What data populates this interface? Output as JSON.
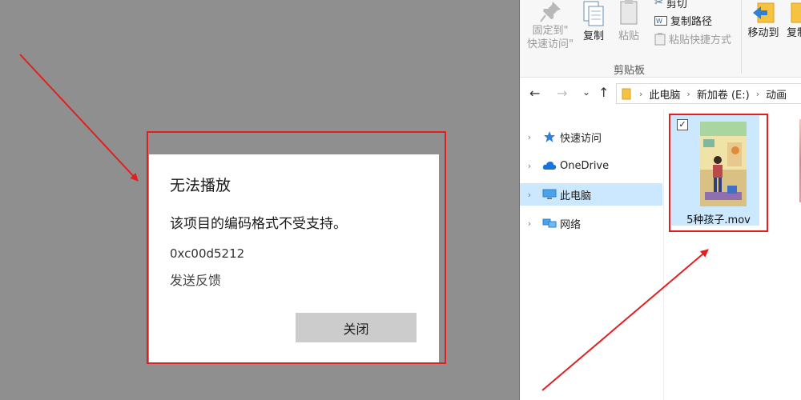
{
  "dialog": {
    "title": "无法播放",
    "message": "该项目的编码格式不受支持。",
    "error_code": "0xc00d5212",
    "feedback_link": "发送反馈",
    "close_label": "关闭"
  },
  "ribbon": {
    "pin_label_line1": "固定到\"",
    "pin_label_line2": "快速访问\"",
    "copy_label": "复制",
    "paste_label": "粘贴",
    "cut_label": "剪切",
    "copy_path_label": "复制路径",
    "paste_shortcut_label": "粘贴快捷方式",
    "group_label": "剪贴板",
    "move_to_label": "移动到",
    "copy_to_label": "复制"
  },
  "address": {
    "crumbs": [
      "此电脑",
      "新加卷 (E:)",
      "动画"
    ]
  },
  "nav_pane": {
    "items": [
      {
        "label": "快速访问",
        "icon": "star-icon"
      },
      {
        "label": "OneDrive",
        "icon": "cloud-icon"
      },
      {
        "label": "此电脑",
        "icon": "computer-icon"
      },
      {
        "label": "网络",
        "icon": "network-icon"
      }
    ]
  },
  "files": [
    {
      "name": "5种孩子.mov",
      "checked": true
    }
  ],
  "colors": {
    "annotation": "#e02020",
    "selection": "#cce8ff",
    "dim_overlay": "#8f8f8f"
  }
}
